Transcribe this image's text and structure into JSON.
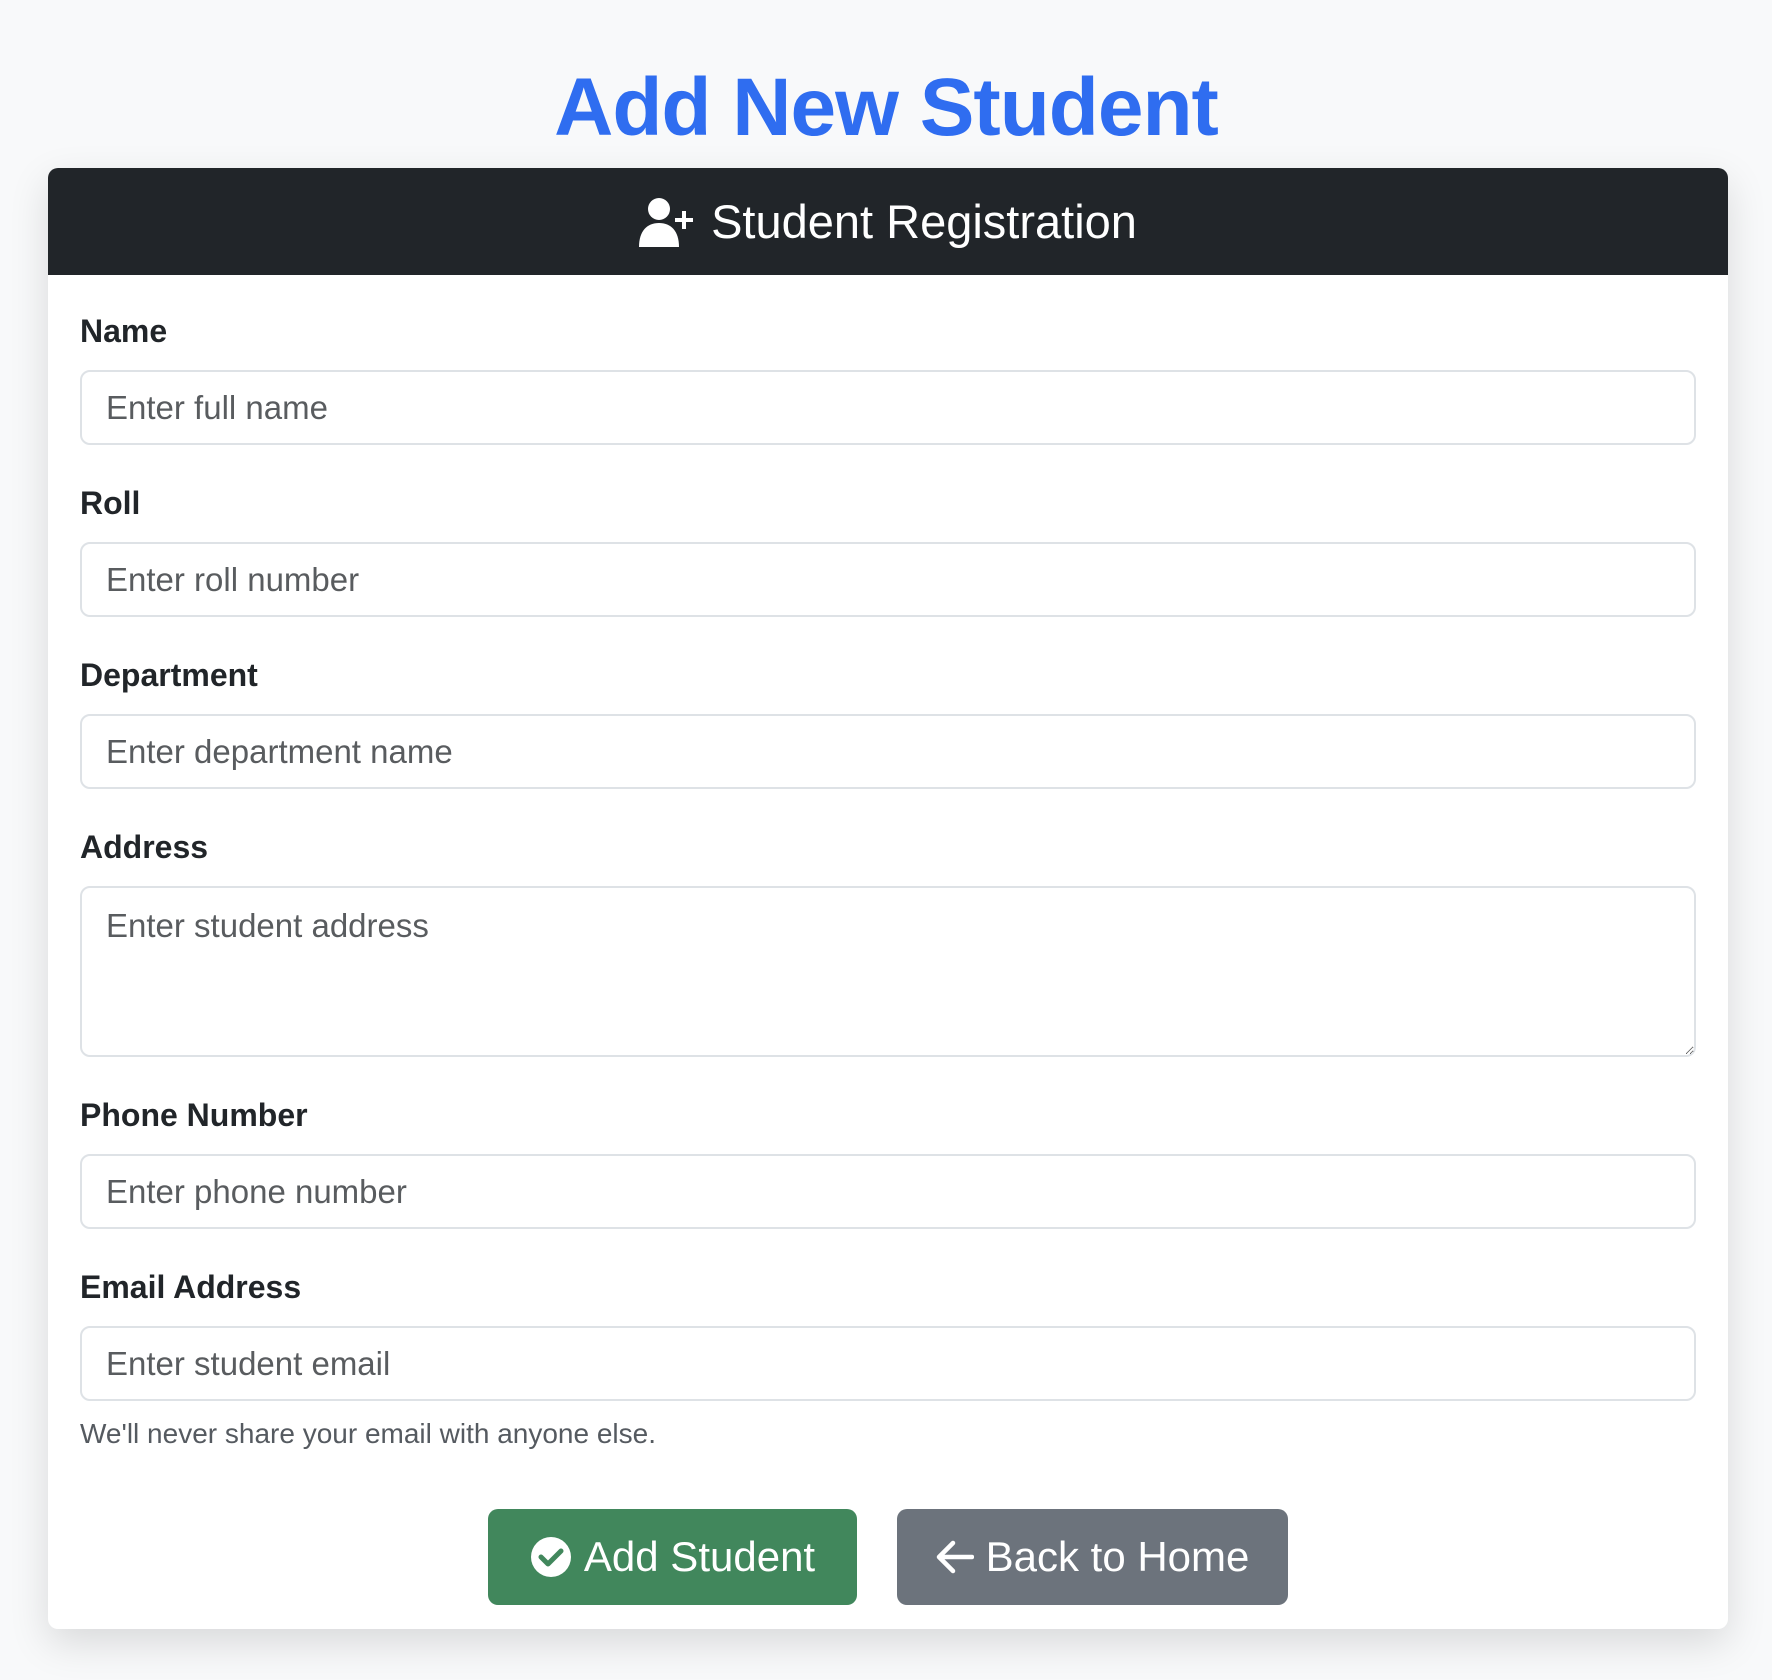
{
  "page": {
    "title": "Add New Student"
  },
  "card": {
    "header_title": "Student Registration",
    "header_icon": "user-plus-icon"
  },
  "form": {
    "fields": [
      {
        "label": "Name",
        "placeholder": "Enter full name",
        "value": ""
      },
      {
        "label": "Roll",
        "placeholder": "Enter roll number",
        "value": ""
      },
      {
        "label": "Department",
        "placeholder": "Enter department name",
        "value": ""
      },
      {
        "label": "Address",
        "placeholder": "Enter student address",
        "value": ""
      },
      {
        "label": "Phone Number",
        "placeholder": "Enter phone number",
        "value": ""
      },
      {
        "label": "Email Address",
        "placeholder": "Enter student email",
        "value": ""
      }
    ],
    "email_help": "We'll never share your email with anyone else."
  },
  "actions": {
    "add_label": "Add Student",
    "add_icon": "check-circle-icon",
    "back_label": "Back to Home",
    "back_icon": "arrow-left-icon"
  },
  "colors": {
    "title": "#2f6df0",
    "header_bg": "#212529",
    "success": "#41875c",
    "secondary": "#6c737c"
  }
}
